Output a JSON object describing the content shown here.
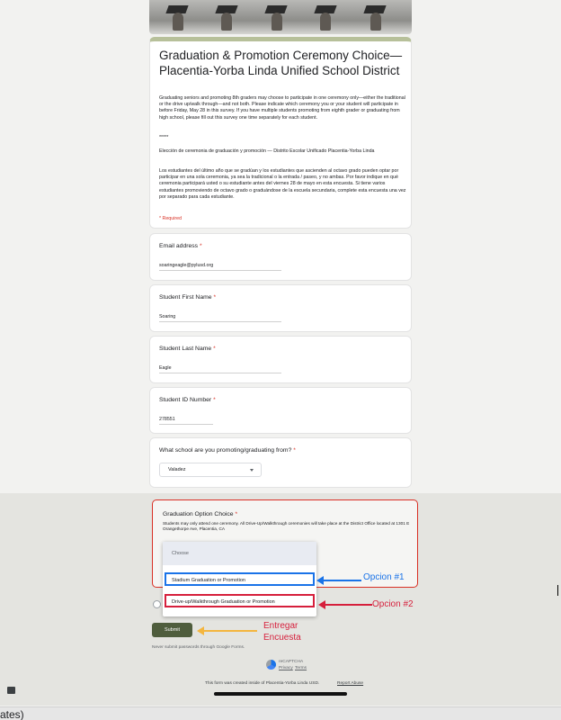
{
  "header": {
    "title": "Graduation & Promotion Ceremony Choice—Placentia-Yorba Linda Unified School District"
  },
  "description": {
    "english": "Graduating seniors and promoting 8th graders may choose to participate in one ceremony only—either the traditional or the drive up/walk through—and not both. Please indicate which ceremony you or your student will participate in before Friday, May 28 in this survey. If you have multiple students promoting from eighth grader or graduating from high school, please fill out this survey one time separately for each student.",
    "separator": "*****",
    "spanish_title": "Elección de ceremonia de graduación y promoción — Distrito Escolar Unificado Placentia-Yorba Linda",
    "spanish_body": "Los estudiantes del último año que se gradúan y los estudiantes que ascienden al octavo grado pueden optar por participar en una sola ceremonia, ya sea la tradicional o la entrada / paseo, y no ambas. Por favor indique en qué ceremonia participará usted o su estudiante antes del viernes 28 de mayo en esta encuesta. Si tiene varios estudiantes promoviendo de octavo grado o graduándose de la escuela secundaria, complete esta encuesta una vez por separado para cada estudiante.",
    "required_note": "* Required"
  },
  "questions": {
    "email": {
      "label": "Email address",
      "required": "*",
      "value": "soaringeagle@pylusd.org"
    },
    "first_name": {
      "label": "Student First Name",
      "required": "*",
      "value": "Soaring"
    },
    "last_name": {
      "label": "Student Last Name",
      "required": "*",
      "value": "Eagle"
    },
    "student_id": {
      "label": "Student ID Number",
      "required": "*",
      "value": "278551"
    },
    "school": {
      "label": "What school are you promoting/graduating from?",
      "required": "*",
      "value": "Valadez"
    },
    "graduation": {
      "label": "Graduation Option Choice",
      "required": "*",
      "description": "Students may only attend one ceremony. All Drive-Up/Walkthrough ceremonies will take place at the District Office located at 1301 E Orangethorpe Ave, Placentia, CA",
      "options": {
        "placeholder": "Choose",
        "option1": "Stadium Graduation or Promotion",
        "option2": "Drive-up/Walkthrough Graduation or Promotion"
      }
    }
  },
  "annotations": {
    "opcion1": "Opcion #1",
    "opcion2": "Opcion #2",
    "submit_line1": "Entregar",
    "submit_line2": "Encuesta",
    "blue_color": "#1a73e8",
    "red_color": "#d61f3c",
    "yellow_color": "#f4b63f"
  },
  "footer": {
    "submit": "Submit",
    "password_note": "Never submit passwords through Google Forms.",
    "recaptcha": "reCAPTCHA",
    "privacy": "Privacy",
    "terms": "Terms",
    "created_inside": "This form was created inside of Placentia-Yorba Linda USD.",
    "report_abuse": "Report Abuse",
    "bottom_text": "ates)"
  }
}
